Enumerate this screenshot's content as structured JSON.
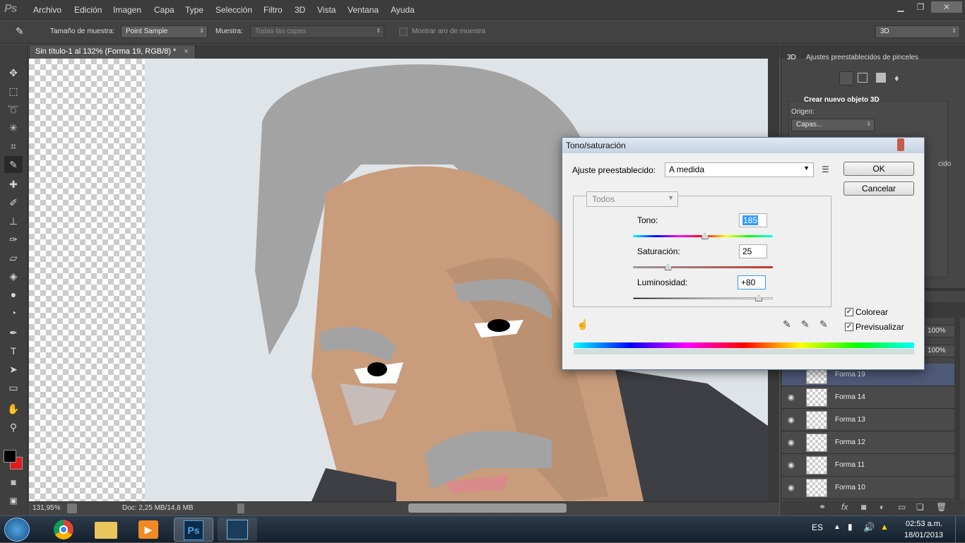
{
  "app": {
    "logo": "Ps"
  },
  "menu": [
    "Archivo",
    "Edición",
    "Imagen",
    "Capa",
    "Type",
    "Selección",
    "Filtro",
    "3D",
    "Vista",
    "Ventana",
    "Ayuda"
  ],
  "window_controls": {
    "minimize": "▁",
    "restore": "❐",
    "close": "✕"
  },
  "options": {
    "sample_size_label": "Tamaño de muestra:",
    "sample_size_value": "Point Sample",
    "sample_label": "Muestra:",
    "sample_value": "Todas las capas",
    "show_ring_label": "Mostrar aro de muestra",
    "workspace_value": "3D"
  },
  "document": {
    "tab_title": "Sin título-1 al 132% (Forma 19, RGB/8) *",
    "close": "×"
  },
  "status": {
    "zoom": "131,95%",
    "doc": "Doc: 2,25 MB/14,8 MB"
  },
  "panel_3d": {
    "tab_3d": "3D",
    "tab_presets": "Ajustes preestablecidos de pinceles",
    "create_title": "Crear nuevo objeto 3D",
    "origin_label": "Origen:",
    "origin_value": "Capas...",
    "hidden_text": "cido"
  },
  "layers": [
    {
      "name": "Forma 19"
    },
    {
      "name": "Forma 14"
    },
    {
      "name": "Forma 13"
    },
    {
      "name": "Forma 12"
    },
    {
      "name": "Forma 11"
    },
    {
      "name": "Forma 10"
    }
  ],
  "opacity_values": [
    "100%",
    "100%"
  ],
  "dialog": {
    "title": "Tono/saturación",
    "preset_label": "Ajuste preestablecido:",
    "preset_value": "A medida",
    "channel_value": "Todos",
    "hue_label": "Tono:",
    "hue_value": "185",
    "sat_label": "Saturación:",
    "sat_value": "25",
    "light_label": "Luminosidad:",
    "light_value": "+80",
    "ok_label": "OK",
    "cancel_label": "Cancelar",
    "colorize_label": "Colorear",
    "preview_label": "Previsualizar",
    "colorize_checked": true,
    "preview_checked": true,
    "hue_range": [
      -180,
      180
    ],
    "sat_range": [
      -100,
      100
    ],
    "light_range": [
      -100,
      100
    ]
  },
  "taskbar": {
    "lang": "ES",
    "time": "02:53 a.m.",
    "date": "18/01/2013",
    "ps_label": "Ps"
  }
}
